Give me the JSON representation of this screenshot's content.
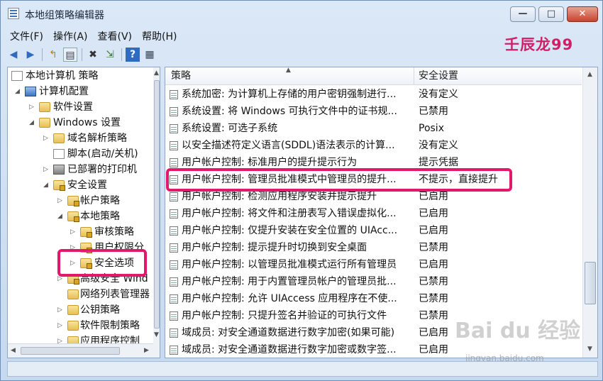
{
  "window": {
    "title": "本地组策略编辑器",
    "min": "—",
    "max": "□",
    "close": "✕"
  },
  "menu": [
    "文件(F)",
    "操作(A)",
    "查看(V)",
    "帮助(H)"
  ],
  "toolbar": {
    "back": "◀",
    "forward": "▶",
    "up": "↰",
    "show_tree": "▤",
    "delete": "✖",
    "export": "⇲",
    "help": "?",
    "view": "▦"
  },
  "watermark": "壬辰龙99",
  "tree": [
    {
      "label": "本地计算机 策略",
      "icon": "doc"
    },
    {
      "label": "计算机配置",
      "icon": "computer"
    },
    {
      "label": "软件设置",
      "icon": "folder"
    },
    {
      "label": "Windows 设置",
      "icon": "folder"
    },
    {
      "label": "域名解析策略",
      "icon": "folder"
    },
    {
      "label": "脚本(启动/关机)",
      "icon": "doc"
    },
    {
      "label": "已部署的打印机",
      "icon": "printer"
    },
    {
      "label": "安全设置",
      "icon": "lockfolder"
    },
    {
      "label": "帐户策略",
      "icon": "lockfolder"
    },
    {
      "label": "本地策略",
      "icon": "lockfolder"
    },
    {
      "label": "审核策略",
      "icon": "lockfolder"
    },
    {
      "label": "用户权限分",
      "icon": "lockfolder"
    },
    {
      "label": "安全选项",
      "icon": "lockfolder"
    },
    {
      "label": "高级安全 Wind",
      "icon": "lockfolder"
    },
    {
      "label": "网络列表管理器",
      "icon": "folder"
    },
    {
      "label": "公钥策略",
      "icon": "folder"
    },
    {
      "label": "软件限制策略",
      "icon": "folder"
    },
    {
      "label": "应用程序控制",
      "icon": "folder"
    }
  ],
  "columns": {
    "policy": "策略",
    "setting": "安全设置"
  },
  "policies": [
    {
      "name": "系统加密: 为计算机上存储的用户密钥强制进行...",
      "value": "没有定义"
    },
    {
      "name": "系统设置: 将 Windows 可执行文件中的证书规...",
      "value": "已禁用"
    },
    {
      "name": "系统设置: 可选子系统",
      "value": "Posix"
    },
    {
      "name": "以安全描述符定义语言(SDDL)语法表示的计算...",
      "value": "没有定义"
    },
    {
      "name": "用户帐户控制: 标准用户的提升提示行为",
      "value": "提示凭据"
    },
    {
      "name": "用户帐户控制: 管理员批准模式中管理员的提升...",
      "value": "不提示，直接提升"
    },
    {
      "name": "用户帐户控制: 检测应用程序安装并提示提升",
      "value": "已启用"
    },
    {
      "name": "用户帐户控制: 将文件和注册表写入错误虚拟化...",
      "value": "已启用"
    },
    {
      "name": "用户帐户控制: 仅提升安装在安全位置的 UIAcc...",
      "value": "已启用"
    },
    {
      "name": "用户帐户控制: 提示提升时切换到安全桌面",
      "value": "已禁用"
    },
    {
      "name": "用户帐户控制: 以管理员批准模式运行所有管理员",
      "value": "已启用"
    },
    {
      "name": "用户帐户控制: 用于内置管理员帐户的管理员批...",
      "value": "已禁用"
    },
    {
      "name": "用户帐户控制: 允许 UIAccess 应用程序在不使...",
      "value": "已禁用"
    },
    {
      "name": "用户帐户控制: 只提升签名并验证的可执行文件",
      "value": "已禁用"
    },
    {
      "name": "域成员: 对安全通道数据进行数字加密(如果可能)",
      "value": "已启用"
    },
    {
      "name": "域成员: 对安全通道数据进行数字加密或数字签...",
      "value": "已启用"
    }
  ],
  "baidu": {
    "logo": "Bai du 经验",
    "url": "jingyan.baidu.com"
  },
  "colors": {
    "highlight": "#e2186c",
    "watermark": "#d11f67"
  }
}
